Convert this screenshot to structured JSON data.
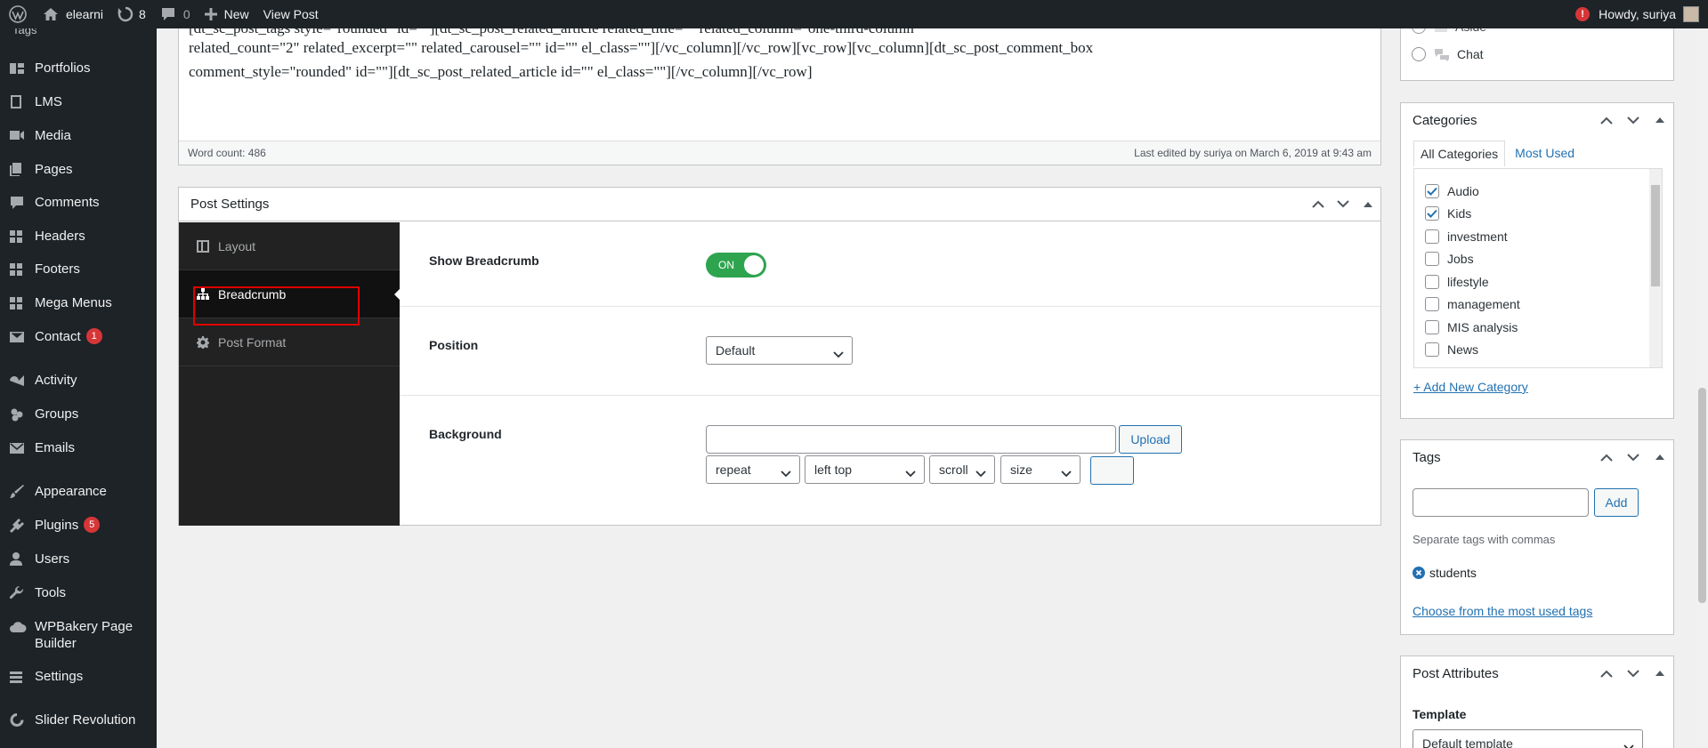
{
  "adminbar": {
    "site_name": "elearni",
    "updates_count": "8",
    "comments_count": "0",
    "new_label": "New",
    "view_post_label": "View Post",
    "notification_badge": "!",
    "howdy_label": "Howdy, suriya"
  },
  "sidebar": {
    "tags_label": "Tags",
    "items": [
      {
        "label": "Portfolios",
        "icon": "portfolio-icon"
      },
      {
        "label": "LMS",
        "icon": "book-icon"
      },
      {
        "label": "Media",
        "icon": "media-icon"
      },
      {
        "label": "Pages",
        "icon": "pages-icon"
      },
      {
        "label": "Comments",
        "icon": "comment-icon"
      },
      {
        "label": "Headers",
        "icon": "grid-icon"
      },
      {
        "label": "Footers",
        "icon": "grid-icon"
      },
      {
        "label": "Mega Menus",
        "icon": "grid-icon"
      },
      {
        "label": "Contact",
        "icon": "mail-icon",
        "badge": "1"
      },
      {
        "label": "Activity",
        "icon": "activity-icon"
      },
      {
        "label": "Groups",
        "icon": "groups-icon"
      },
      {
        "label": "Emails",
        "icon": "mail-icon"
      },
      {
        "label": "Appearance",
        "icon": "brush-icon"
      },
      {
        "label": "Plugins",
        "icon": "plugin-icon",
        "badge": "5"
      },
      {
        "label": "Users",
        "icon": "user-icon"
      },
      {
        "label": "Tools",
        "icon": "wrench-icon"
      },
      {
        "label": "WPBakery Page Builder",
        "icon": "cloud-icon"
      },
      {
        "label": "Settings",
        "icon": "settings-icon"
      },
      {
        "label": "Slider Revolution",
        "icon": "refresh-icon"
      }
    ]
  },
  "editor": {
    "line0": "[dt_sc_post_tags style=\"rounded\" id=\"\"][dt_sc_post_related_article related_title=\"\" related_column=\"one-third-column\"",
    "line1": "related_count=\"2\" related_excerpt=\"\" related_carousel=\"\" id=\"\" el_class=\"\"][/vc_column][/vc_row][vc_row][vc_column][dt_sc_post_comment_box",
    "line2": "comment_style=\"rounded\" id=\"\"][dt_sc_post_related_article id=\"\" el_class=\"\"][/vc_column][/vc_row]",
    "word_count": "Word count: 486",
    "last_edited": "Last edited by suriya on March 6, 2019 at 9:43 am"
  },
  "post_settings": {
    "title": "Post Settings",
    "tabs": [
      "Layout",
      "Breadcrumb",
      "Post Format"
    ],
    "show_breadcrumb_label": "Show Breadcrumb",
    "toggle_state": "ON",
    "position_label": "Position",
    "position_value": "Default",
    "background_label": "Background",
    "upload_label": "Upload",
    "repeat_value": "repeat",
    "bg_position_value": "left top",
    "attachment_value": "scroll",
    "size_value": "size"
  },
  "format_box": {
    "items": [
      "Aside",
      "Chat"
    ]
  },
  "categories": {
    "title": "Categories",
    "tab_all": "All Categories",
    "tab_most_used": "Most Used",
    "items": [
      {
        "label": "Audio",
        "checked": true
      },
      {
        "label": "Kids",
        "checked": true
      },
      {
        "label": "investment",
        "checked": false
      },
      {
        "label": "Jobs",
        "checked": false
      },
      {
        "label": "lifestyle",
        "checked": false
      },
      {
        "label": "management",
        "checked": false
      },
      {
        "label": "MIS analysis",
        "checked": false
      },
      {
        "label": "News",
        "checked": false
      }
    ],
    "add_new": "+ Add New Category"
  },
  "tags": {
    "title": "Tags",
    "add_label": "Add",
    "help": "Separate tags with commas",
    "tag": "students",
    "choose_link": "Choose from the most used tags"
  },
  "post_attributes": {
    "title": "Post Attributes",
    "template_label": "Template",
    "template_value": "Default template"
  },
  "colors": {
    "admin_dark": "#1d2327",
    "link_blue": "#2271b1",
    "toggle_green": "#2ea44f",
    "badge_red": "#d63638",
    "highlight_red": "#e00000"
  }
}
